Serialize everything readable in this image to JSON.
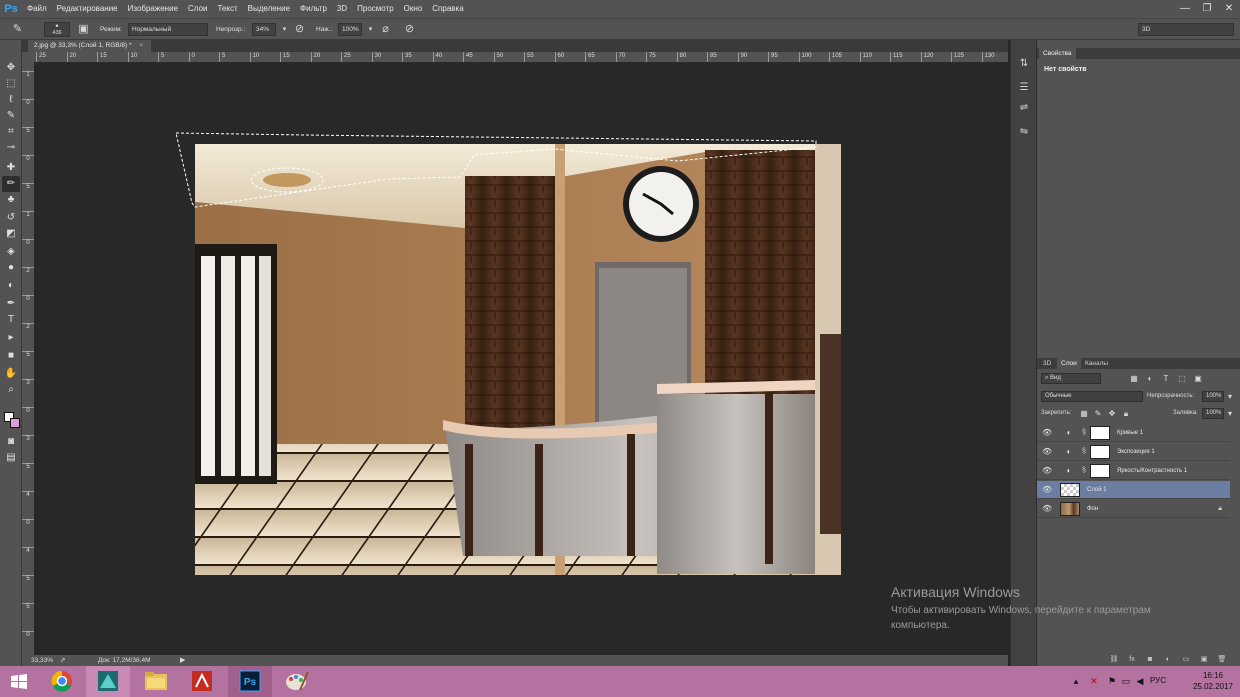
{
  "app": {
    "logo": "Ps"
  },
  "menu": {
    "items": [
      "Файл",
      "Редактирование",
      "Изображение",
      "Слои",
      "Текст",
      "Выделение",
      "Фильтр",
      "3D",
      "Просмотр",
      "Окно",
      "Справка"
    ]
  },
  "window_controls": {
    "minimize": "—",
    "restore": "❐",
    "close": "✕"
  },
  "options": {
    "brush_size": "436",
    "mode_label": "Режим:",
    "mode_value": "Нормальный",
    "opacity_label": "Непрозр.:",
    "opacity_value": "34%",
    "flow_label": "Наж.:",
    "flow_value": "100%",
    "workspace": "3D"
  },
  "document": {
    "tab_title": "2.jpg @ 33,3% (Слой 1, RGB/8) *",
    "tab_close": "×",
    "zoom": "33,33%",
    "doc_info": "Док: 17,2M/38,4M"
  },
  "rulers": {
    "horizontal": [
      "25",
      "20",
      "15",
      "10",
      "5",
      "0",
      "5",
      "10",
      "15",
      "20",
      "25",
      "30",
      "35",
      "40",
      "45",
      "50",
      "55",
      "60",
      "65",
      "70",
      "75",
      "80",
      "85",
      "90",
      "95",
      "100",
      "105",
      "110",
      "115",
      "120",
      "125",
      "130"
    ],
    "vertical": [
      "1",
      "0",
      "5",
      "0",
      "5",
      "1",
      "0",
      "2",
      "0",
      "2",
      "5",
      "3",
      "0",
      "3",
      "5",
      "4",
      "0",
      "4",
      "5",
      "5",
      "0"
    ]
  },
  "toolbar": {
    "tools": [
      {
        "name": "move-tool",
        "glyph": "✥"
      },
      {
        "name": "marquee-tool",
        "glyph": "⬚"
      },
      {
        "name": "lasso-tool",
        "glyph": "ℓ"
      },
      {
        "name": "quick-select-tool",
        "glyph": "✎"
      },
      {
        "name": "crop-tool",
        "glyph": "⌗"
      },
      {
        "name": "eyedropper-tool",
        "glyph": "⊸"
      },
      {
        "name": "healing-tool",
        "glyph": "✚"
      },
      {
        "name": "brush-tool",
        "glyph": "✏"
      },
      {
        "name": "stamp-tool",
        "glyph": "♣"
      },
      {
        "name": "history-brush-tool",
        "glyph": "↺"
      },
      {
        "name": "eraser-tool",
        "glyph": "◩"
      },
      {
        "name": "bucket-tool",
        "glyph": "◈"
      },
      {
        "name": "blur-tool",
        "glyph": "●"
      },
      {
        "name": "dodge-tool",
        "glyph": "◐"
      },
      {
        "name": "pen-tool",
        "glyph": "✒"
      },
      {
        "name": "type-tool",
        "glyph": "T"
      },
      {
        "name": "path-select-tool",
        "glyph": "▸"
      },
      {
        "name": "shape-tool",
        "glyph": "■"
      },
      {
        "name": "hand-tool",
        "glyph": "✋"
      },
      {
        "name": "zoom-tool",
        "glyph": "⌕"
      }
    ]
  },
  "dock_icons": [
    "⇅",
    "☰",
    "⇌",
    "⇋"
  ],
  "properties_panel": {
    "tab": "Свойства",
    "empty_text": "Нет свойств"
  },
  "layers_panel": {
    "tabs": [
      "3D",
      "Слои",
      "Каналы"
    ],
    "filter_label": "Вид",
    "blend_mode": "Обычные",
    "opacity_label": "Непрозрачность:",
    "opacity_value": "100%",
    "lock_label": "Закрепить:",
    "fill_label": "Заливка:",
    "fill_value": "100%",
    "layers": [
      {
        "name": "Кривые 1",
        "kind": "adjustment",
        "selected": false
      },
      {
        "name": "Экспозиция 1",
        "kind": "adjustment",
        "selected": false
      },
      {
        "name": "Яркость/Контрастность 1",
        "kind": "adjustment",
        "selected": false
      },
      {
        "name": "Слой 1",
        "kind": "pixel",
        "selected": true
      },
      {
        "name": "Фон",
        "kind": "background",
        "selected": false
      }
    ]
  },
  "watermark": {
    "title": "Активация Windows",
    "text": "Чтобы активировать Windows, перейдите к параметрам компьютера."
  },
  "taskbar": {
    "apps": [
      "chrome",
      "autodesk",
      "explorer",
      "acrobat",
      "photoshop",
      "paint"
    ],
    "language": "РУС",
    "time": "16:16",
    "date": "25.02.2017"
  },
  "colors": {
    "ui_bg": "#535353",
    "canvas_bg": "#282828",
    "taskbar": "#b3729f",
    "selected_layer": "#6b7da0",
    "ps_blue": "#31a8ff"
  }
}
